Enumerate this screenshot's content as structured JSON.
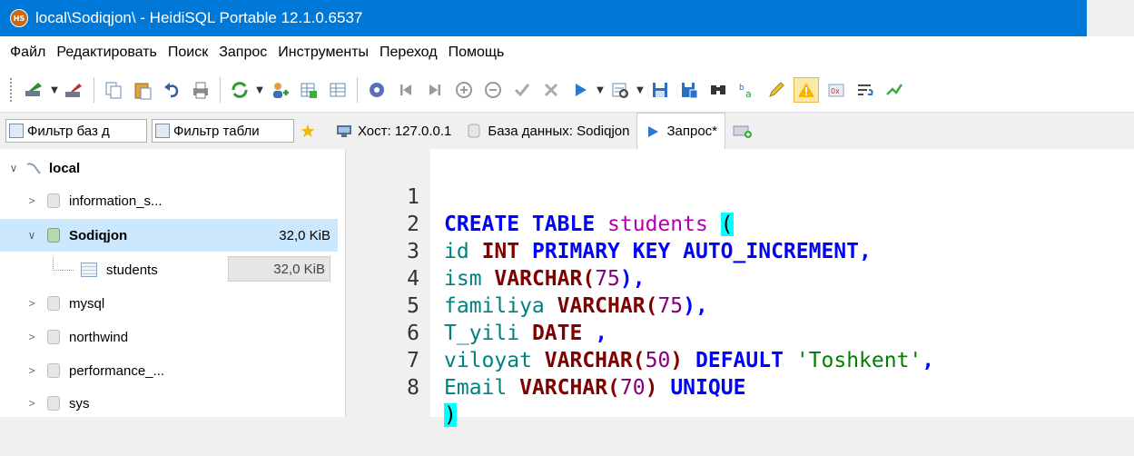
{
  "window": {
    "app_icon_text": "HS",
    "title": "local\\Sodiqjon\\ - HeidiSQL Portable 12.1.0.6537"
  },
  "menu": [
    "Файл",
    "Редактировать",
    "Поиск",
    "Запрос",
    "Инструменты",
    "Переход",
    "Помощь"
  ],
  "toolbar": {
    "icons": [
      "connect-icon",
      "disconnect-icon",
      "copy-icon",
      "paste-icon",
      "undo-icon",
      "print-icon",
      "refresh-icon",
      "add-user-icon",
      "table-export-icon",
      "grid-icon",
      "stop-icon",
      "first-icon",
      "last-icon",
      "add-row-icon",
      "delete-row-icon",
      "post-icon",
      "cancel-icon",
      "run-icon",
      "explain-icon",
      "save-icon",
      "save-as-icon",
      "find-icon",
      "replace-icon",
      "edit-icon",
      "warning-icon",
      "null-icon",
      "wrap-icon",
      "format-icon"
    ],
    "active_icon": "warning-icon"
  },
  "filters": {
    "db_filter": "Фильтр баз д",
    "table_filter": "Фильтр табли"
  },
  "tabs": [
    {
      "label": "Хост: 127.0.0.1",
      "icon": "host-icon"
    },
    {
      "label": "База данных: Sodiqjon",
      "icon": "database-icon"
    },
    {
      "label": "Запрос*",
      "icon": "query-icon"
    }
  ],
  "tree": {
    "root": "local",
    "items": [
      {
        "label": "information_s...",
        "size": "",
        "selected": false,
        "type": "db"
      },
      {
        "label": "Sodiqjon",
        "size": "32,0 KiB",
        "selected": true,
        "type": "db"
      },
      {
        "label": "students",
        "size": "32,0 KiB",
        "selected": false,
        "type": "table"
      },
      {
        "label": "mysql",
        "size": "",
        "selected": false,
        "type": "db"
      },
      {
        "label": "northwind",
        "size": "",
        "selected": false,
        "type": "db"
      },
      {
        "label": "performance_...",
        "size": "",
        "selected": false,
        "type": "db"
      },
      {
        "label": "sys",
        "size": "",
        "selected": false,
        "type": "db"
      }
    ]
  },
  "editor": {
    "line_numbers": [
      "1",
      "2",
      "3",
      "4",
      "5",
      "6",
      "7",
      "8"
    ],
    "lines": [
      "CREATE TABLE students (",
      "id INT PRIMARY KEY AUTO_INCREMENT,",
      "ism VARCHAR(75),",
      "familiya VARCHAR(75),",
      "T_yili DATE ,",
      "viloyat VARCHAR(50) DEFAULT 'Toshkent',",
      "Email VARCHAR(70) UNIQUE",
      ")"
    ],
    "tokens": {
      "create_table": "CREATE TABLE",
      "table_name": "students",
      "open_paren": "(",
      "id": "id",
      "int": "INT",
      "pk": "PRIMARY KEY AUTO_INCREMENT",
      "ism": "ism",
      "familiya": "familiya",
      "t_yili": "T_yili",
      "date": "DATE",
      "viloyat": "viloyat",
      "default": "DEFAULT",
      "toshkent": "'Toshkent'",
      "email": "Email",
      "unique": "UNIQUE",
      "varchar": "VARCHAR",
      "n75": "75",
      "n50": "50",
      "n70": "70",
      "close_paren": ")"
    }
  }
}
